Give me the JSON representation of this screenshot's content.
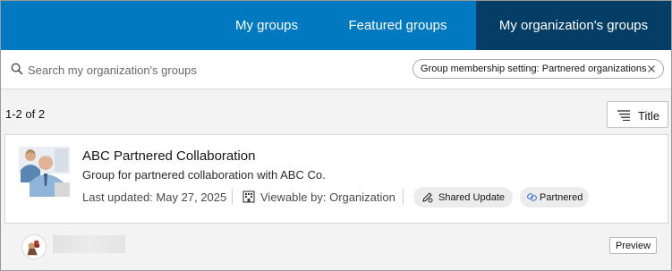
{
  "tabs": {
    "my_groups": "My groups",
    "featured_groups": "Featured groups",
    "org_groups": "My organization's groups",
    "active": "org_groups"
  },
  "search": {
    "placeholder": "Search my organization's groups",
    "value": ""
  },
  "filter_chip": {
    "label": "Group membership setting: Partnered organizations"
  },
  "results": {
    "count_label": "1-2 of 2",
    "sort_label": "Title"
  },
  "group_card": {
    "title": "ABC Partnered Collaboration",
    "description": "Group for partnered collaboration with ABC Co.",
    "last_updated": "Last updated: May 27, 2025",
    "viewable_by": "Viewable by: Organization",
    "badges": [
      "Shared Update",
      "Partnered"
    ]
  },
  "second_row": {
    "preview_label": "Preview"
  },
  "colors": {
    "tab_bar": "#0079c1",
    "tab_active": "#043e66",
    "badge_bg": "#ececec"
  }
}
